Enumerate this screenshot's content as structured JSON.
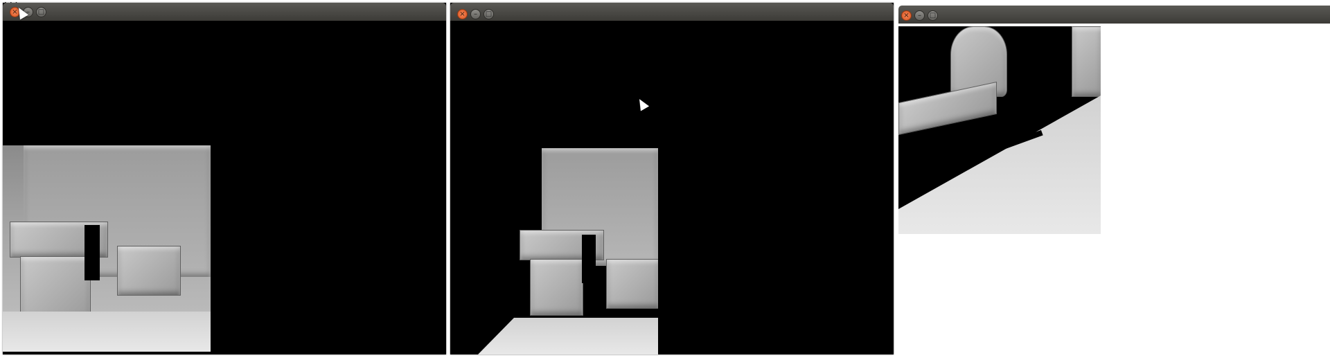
{
  "terminal": {
    "top_fragment": "...",
    "bottom_line": "... ... ...  ... ...  ..."
  },
  "windows": [
    {
      "id": "window-1",
      "buttons": {
        "close_glyph": "×",
        "minimize_glyph": "–",
        "maximize_glyph": "□"
      }
    },
    {
      "id": "window-2",
      "buttons": {
        "close_glyph": "×",
        "minimize_glyph": "–",
        "maximize_glyph": "□"
      }
    },
    {
      "id": "window-3",
      "buttons": {
        "close_glyph": "×",
        "minimize_glyph": "–",
        "maximize_glyph": "□"
      }
    }
  ],
  "colors": {
    "titlebar": "#3c3b37",
    "close_button": "#e2582a",
    "viewport_background": "#000000",
    "render_surface": "#a8a8a8"
  },
  "icons": [
    "close-icon",
    "minimize-icon",
    "maximize-icon",
    "mouse-pointer-icon"
  ]
}
